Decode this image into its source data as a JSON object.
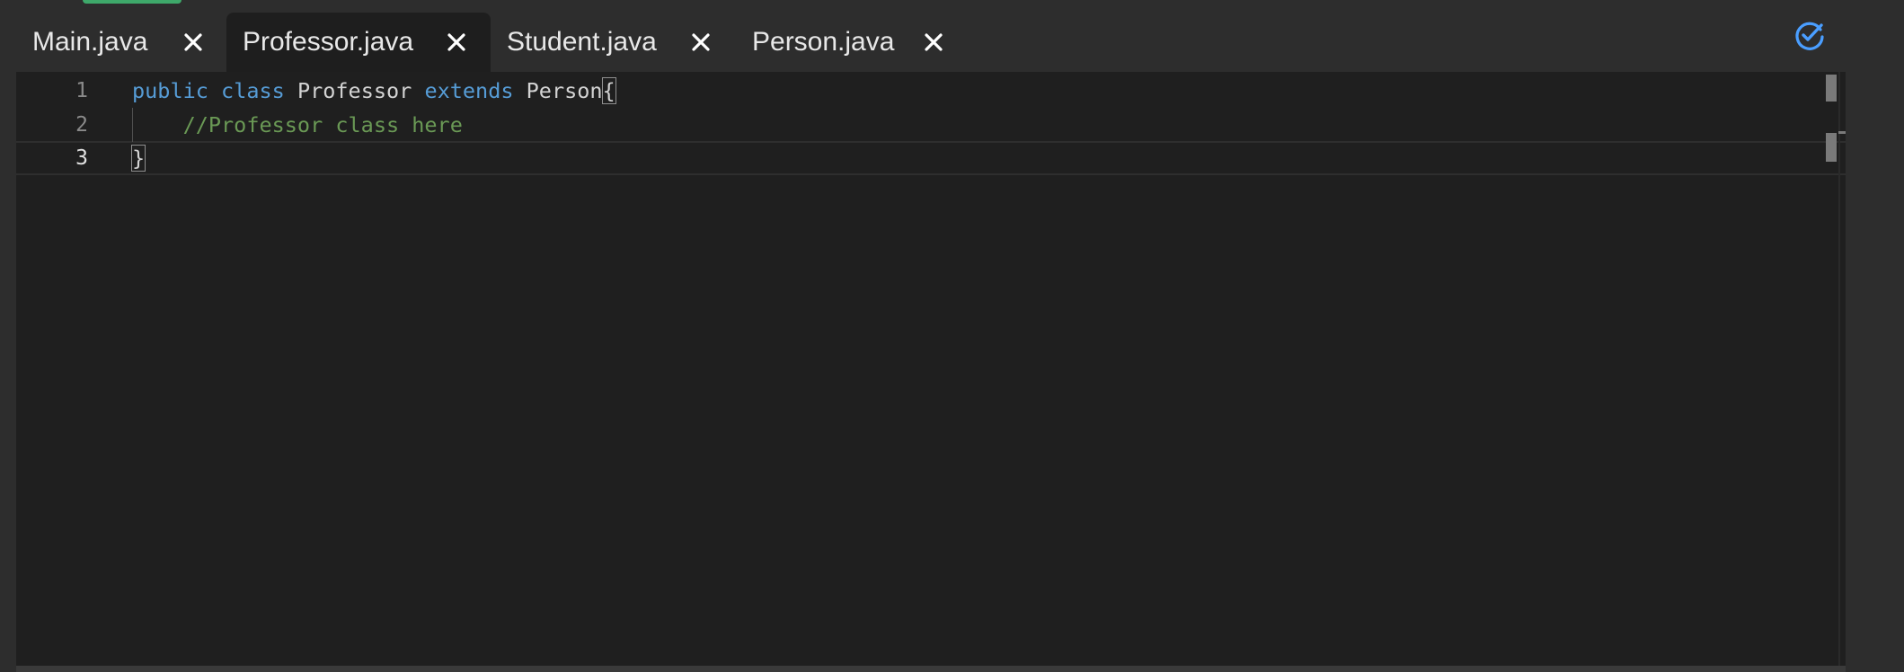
{
  "tabs": [
    {
      "label": "Main.java",
      "active": false
    },
    {
      "label": "Professor.java",
      "active": true
    },
    {
      "label": "Student.java",
      "active": false
    },
    {
      "label": "Person.java",
      "active": false
    }
  ],
  "icons": {
    "close": "close-icon",
    "sync": "check-sync-icon"
  },
  "colors": {
    "keyword": "#569cd6",
    "comment": "#6a9955",
    "text": "#d4d4d4",
    "accent": "#3ea86a",
    "sync_icon": "#4a9eff",
    "editor_bg": "#1f1f1f",
    "tabbar_bg": "#2d2d2d"
  },
  "editor": {
    "line_numbers": [
      "1",
      "2",
      "3"
    ],
    "current_line": 3,
    "lines": {
      "l1_kw1": "public",
      "l1_kw2": "class",
      "l1_name": "Professor",
      "l1_kw3": "extends",
      "l1_parent": "Person",
      "l1_brace": "{",
      "l2_comment": "//Professor class here",
      "l3_brace": "}"
    }
  }
}
